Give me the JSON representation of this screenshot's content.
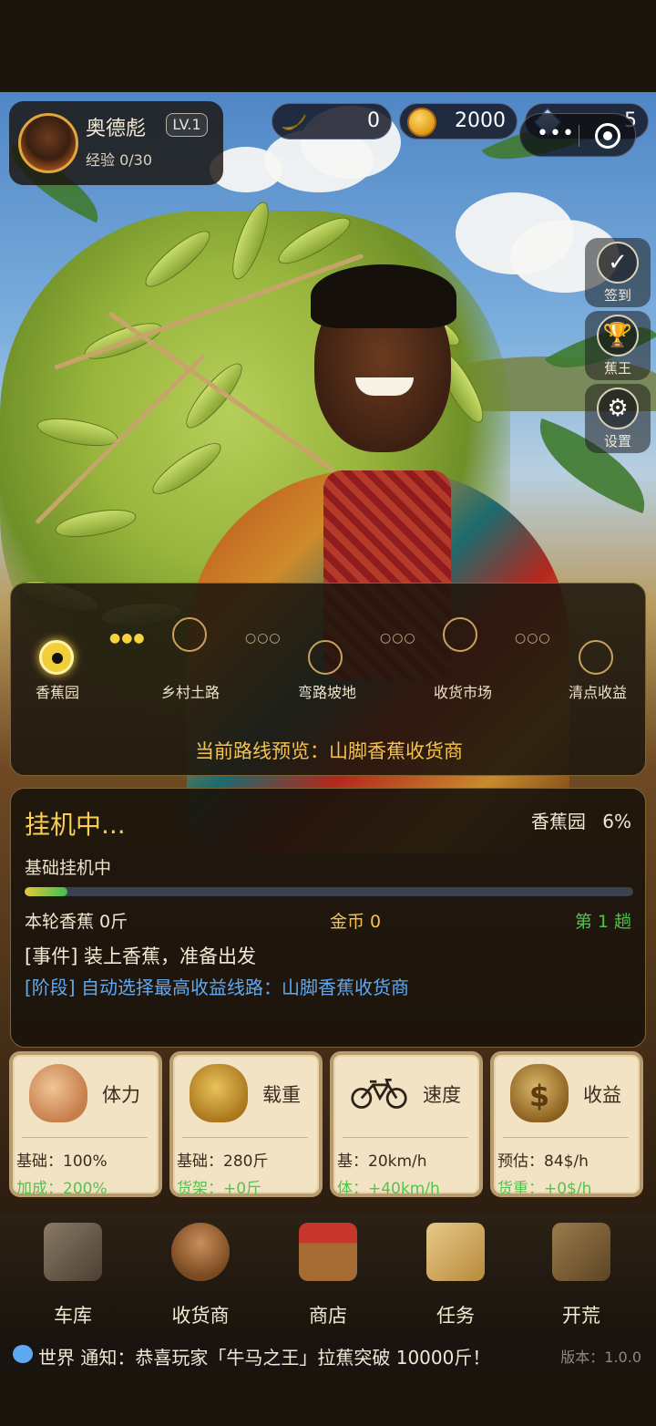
{
  "player": {
    "name": "奥德彪",
    "level": "LV.1",
    "exp": "经验 0/30"
  },
  "currency": {
    "banana": "0",
    "gold": "2000",
    "diamond": "5"
  },
  "side_buttons": [
    {
      "label": "签到",
      "icon": "checkmark-icon"
    },
    {
      "label": "蕉王",
      "icon": "trophy-icon"
    },
    {
      "label": "设置",
      "icon": "gear-icon"
    }
  ],
  "route": {
    "nodes": [
      "香蕉园",
      "乡村土路",
      "弯路坡地",
      "收货市场",
      "清点收益"
    ],
    "preview": "当前路线预览：山脚香蕉收货商"
  },
  "idle": {
    "title": "挂机中...",
    "location": "香蕉园",
    "percent": "6%",
    "progress": 0.07,
    "mode": "基础挂机中",
    "bananas_round": "本轮香蕉 0斤",
    "gold_round": "金币 0",
    "trip": "第 1 趟",
    "event": "[事件] 装上香蕉，准备出发",
    "phase": "[阶段] 自动选择最高收益线路：山脚香蕉收货商"
  },
  "stats": [
    {
      "name": "体力",
      "line1": "基础：100%",
      "line2": "加成：200%",
      "icon": "flexed-arm-icon"
    },
    {
      "name": "载重",
      "line1": "基础：280斤",
      "line2": "货架：+0斤",
      "icon": "sack-icon"
    },
    {
      "name": "速度",
      "line1": "基：20km/h",
      "line2": "体：+40km/h",
      "icon": "bicycle-icon"
    },
    {
      "name": "收益",
      "line1": "预估：84$/h",
      "line2": "货重：+0$/h",
      "icon": "money-bag-icon"
    }
  ],
  "nav": [
    "车库",
    "收货商",
    "商店",
    "任务",
    "开荒"
  ],
  "notice": "世界 通知：恭喜玩家「牛马之王」拉蕉突破 10000斤！",
  "version": "版本：1.0.0",
  "colors": {
    "accent_gold": "#f4c24f",
    "phase_blue": "#5fa9f2",
    "bonus_green": "#53c34c"
  }
}
